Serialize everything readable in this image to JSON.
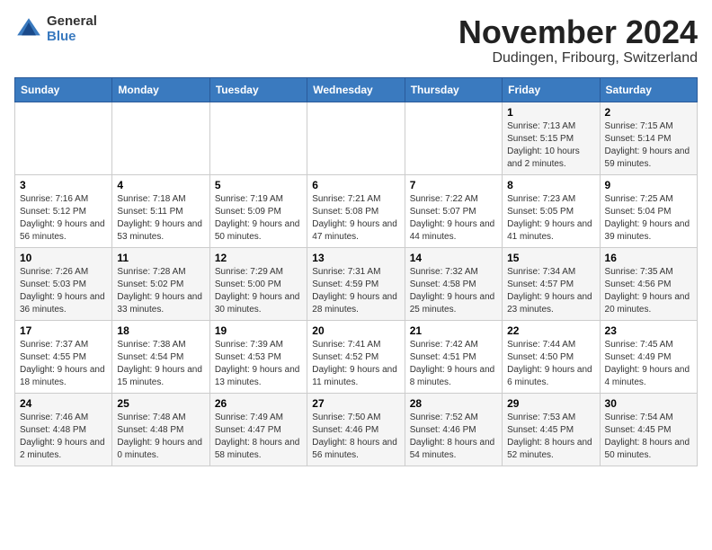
{
  "logo": {
    "general": "General",
    "blue": "Blue"
  },
  "title": {
    "month": "November 2024",
    "location": "Dudingen, Fribourg, Switzerland"
  },
  "weekdays": [
    "Sunday",
    "Monday",
    "Tuesday",
    "Wednesday",
    "Thursday",
    "Friday",
    "Saturday"
  ],
  "weeks": [
    [
      {
        "day": "",
        "info": ""
      },
      {
        "day": "",
        "info": ""
      },
      {
        "day": "",
        "info": ""
      },
      {
        "day": "",
        "info": ""
      },
      {
        "day": "",
        "info": ""
      },
      {
        "day": "1",
        "info": "Sunrise: 7:13 AM\nSunset: 5:15 PM\nDaylight: 10 hours and 2 minutes."
      },
      {
        "day": "2",
        "info": "Sunrise: 7:15 AM\nSunset: 5:14 PM\nDaylight: 9 hours and 59 minutes."
      }
    ],
    [
      {
        "day": "3",
        "info": "Sunrise: 7:16 AM\nSunset: 5:12 PM\nDaylight: 9 hours and 56 minutes."
      },
      {
        "day": "4",
        "info": "Sunrise: 7:18 AM\nSunset: 5:11 PM\nDaylight: 9 hours and 53 minutes."
      },
      {
        "day": "5",
        "info": "Sunrise: 7:19 AM\nSunset: 5:09 PM\nDaylight: 9 hours and 50 minutes."
      },
      {
        "day": "6",
        "info": "Sunrise: 7:21 AM\nSunset: 5:08 PM\nDaylight: 9 hours and 47 minutes."
      },
      {
        "day": "7",
        "info": "Sunrise: 7:22 AM\nSunset: 5:07 PM\nDaylight: 9 hours and 44 minutes."
      },
      {
        "day": "8",
        "info": "Sunrise: 7:23 AM\nSunset: 5:05 PM\nDaylight: 9 hours and 41 minutes."
      },
      {
        "day": "9",
        "info": "Sunrise: 7:25 AM\nSunset: 5:04 PM\nDaylight: 9 hours and 39 minutes."
      }
    ],
    [
      {
        "day": "10",
        "info": "Sunrise: 7:26 AM\nSunset: 5:03 PM\nDaylight: 9 hours and 36 minutes."
      },
      {
        "day": "11",
        "info": "Sunrise: 7:28 AM\nSunset: 5:02 PM\nDaylight: 9 hours and 33 minutes."
      },
      {
        "day": "12",
        "info": "Sunrise: 7:29 AM\nSunset: 5:00 PM\nDaylight: 9 hours and 30 minutes."
      },
      {
        "day": "13",
        "info": "Sunrise: 7:31 AM\nSunset: 4:59 PM\nDaylight: 9 hours and 28 minutes."
      },
      {
        "day": "14",
        "info": "Sunrise: 7:32 AM\nSunset: 4:58 PM\nDaylight: 9 hours and 25 minutes."
      },
      {
        "day": "15",
        "info": "Sunrise: 7:34 AM\nSunset: 4:57 PM\nDaylight: 9 hours and 23 minutes."
      },
      {
        "day": "16",
        "info": "Sunrise: 7:35 AM\nSunset: 4:56 PM\nDaylight: 9 hours and 20 minutes."
      }
    ],
    [
      {
        "day": "17",
        "info": "Sunrise: 7:37 AM\nSunset: 4:55 PM\nDaylight: 9 hours and 18 minutes."
      },
      {
        "day": "18",
        "info": "Sunrise: 7:38 AM\nSunset: 4:54 PM\nDaylight: 9 hours and 15 minutes."
      },
      {
        "day": "19",
        "info": "Sunrise: 7:39 AM\nSunset: 4:53 PM\nDaylight: 9 hours and 13 minutes."
      },
      {
        "day": "20",
        "info": "Sunrise: 7:41 AM\nSunset: 4:52 PM\nDaylight: 9 hours and 11 minutes."
      },
      {
        "day": "21",
        "info": "Sunrise: 7:42 AM\nSunset: 4:51 PM\nDaylight: 9 hours and 8 minutes."
      },
      {
        "day": "22",
        "info": "Sunrise: 7:44 AM\nSunset: 4:50 PM\nDaylight: 9 hours and 6 minutes."
      },
      {
        "day": "23",
        "info": "Sunrise: 7:45 AM\nSunset: 4:49 PM\nDaylight: 9 hours and 4 minutes."
      }
    ],
    [
      {
        "day": "24",
        "info": "Sunrise: 7:46 AM\nSunset: 4:48 PM\nDaylight: 9 hours and 2 minutes."
      },
      {
        "day": "25",
        "info": "Sunrise: 7:48 AM\nSunset: 4:48 PM\nDaylight: 9 hours and 0 minutes."
      },
      {
        "day": "26",
        "info": "Sunrise: 7:49 AM\nSunset: 4:47 PM\nDaylight: 8 hours and 58 minutes."
      },
      {
        "day": "27",
        "info": "Sunrise: 7:50 AM\nSunset: 4:46 PM\nDaylight: 8 hours and 56 minutes."
      },
      {
        "day": "28",
        "info": "Sunrise: 7:52 AM\nSunset: 4:46 PM\nDaylight: 8 hours and 54 minutes."
      },
      {
        "day": "29",
        "info": "Sunrise: 7:53 AM\nSunset: 4:45 PM\nDaylight: 8 hours and 52 minutes."
      },
      {
        "day": "30",
        "info": "Sunrise: 7:54 AM\nSunset: 4:45 PM\nDaylight: 8 hours and 50 minutes."
      }
    ]
  ]
}
